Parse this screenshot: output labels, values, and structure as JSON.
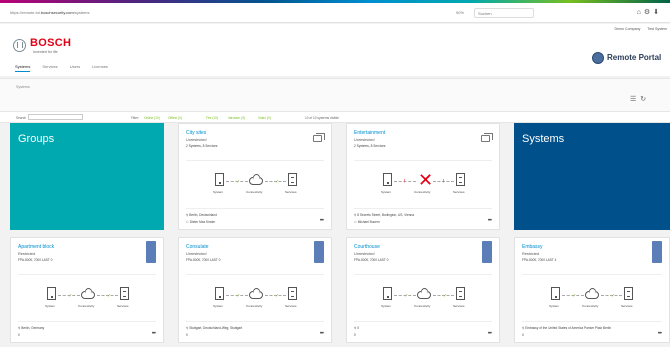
{
  "browser": {
    "url_prefix": "https://remote.iot.",
    "url_domain": "boschsecurity.com",
    "url_suffix": "/systems",
    "zoom": "90%",
    "search_placeholder": "Suchen"
  },
  "header": {
    "brand": "BOSCH",
    "tagline": "Invented for life",
    "company": "Demo Company",
    "user": "Test System",
    "portal_title": "Remote Portal"
  },
  "tabs": [
    {
      "label": "Systems"
    },
    {
      "label": "Services"
    },
    {
      "label": "Users"
    },
    {
      "label": "Licenses"
    }
  ],
  "breadcrumb": "Systems",
  "filterbar": {
    "search_label": "Search",
    "filter_label": "Filter:",
    "chips": [
      "Online (10)",
      "Offline (0)",
      "Fire (10)",
      "Intrusion (3)",
      "Video (0)"
    ],
    "count": "10 of 10 systems visible"
  },
  "diagram_labels": {
    "system": "System",
    "connectivity": "Connectivity",
    "services": "Services"
  },
  "groups_card": {
    "title": "Groups"
  },
  "systems_card": {
    "title": "Systems"
  },
  "group_cards": [
    {
      "title": "City sites",
      "restriction": "Unrestricted",
      "meta": "2 Systems, 8 Services",
      "location": "Berlin, Deutschland",
      "owner": "Dieter Max Kinder",
      "status": "ok"
    },
    {
      "title": "Entertainment",
      "restriction": "Unrestricted",
      "meta": "2 Systems, 8 Services",
      "location": "8 Secrets Street, Burlington, US, Vienna",
      "owner": "Michael Bucern",
      "status": "error"
    }
  ],
  "system_cards": [
    {
      "title": "Apartment block",
      "restriction": "Restricted",
      "meta": "FPA-5000, 7000 LAST 0",
      "location": "Berlin, Germany",
      "owner": "0"
    },
    {
      "title": "Consulate",
      "restriction": "Unrestricted",
      "meta": "FPA-5000, 7000 LAST 0",
      "location": "Stuttgart, Deutschland-Weg, Stuttgart",
      "owner": "0"
    },
    {
      "title": "Courthouse",
      "restriction": "Unrestricted",
      "meta": "FPA-5000, 7000 LAST 0",
      "location": "0",
      "owner": "0"
    },
    {
      "title": "Embassy",
      "restriction": "Restricted",
      "meta": "FPA-5000, 7000 LAST 4",
      "location": "Embassy of the United States of America Pariser Platz Berlin",
      "owner": "0"
    }
  ],
  "icons": {
    "gallery": "gallery-icon",
    "tag": "tag-icon",
    "device": "panel-icon",
    "cloud": "cloud-icon",
    "service": "service-icon",
    "location": "location-icon",
    "owner": "user-icon",
    "more": "more-icon"
  }
}
